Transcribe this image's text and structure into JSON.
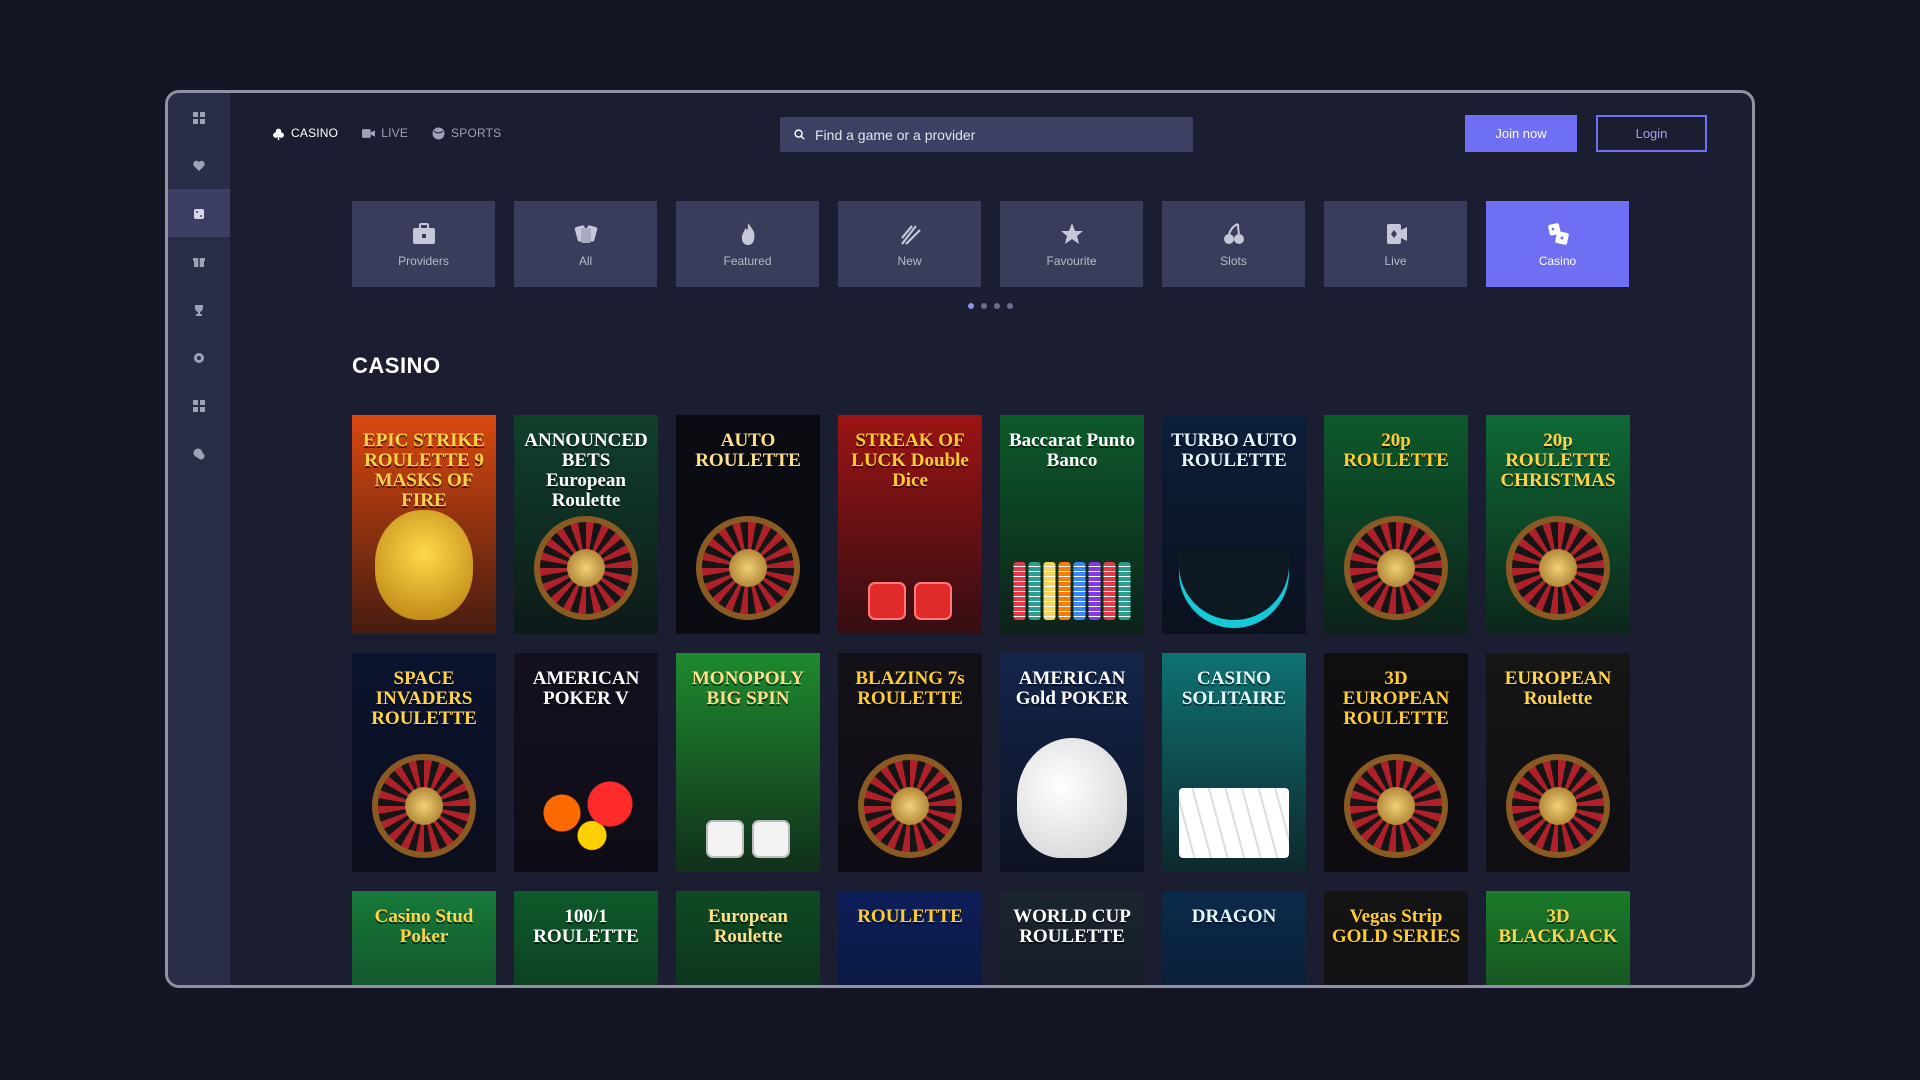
{
  "sidebar": {
    "items": [
      {
        "name": "sidebar-dashboard-icon",
        "active": false
      },
      {
        "name": "sidebar-favourites-icon",
        "active": false
      },
      {
        "name": "sidebar-casino-icon",
        "active": true
      },
      {
        "name": "sidebar-promotions-icon",
        "active": false
      },
      {
        "name": "sidebar-tournaments-icon",
        "active": false
      },
      {
        "name": "sidebar-settings-icon",
        "active": false
      },
      {
        "name": "sidebar-games-icon",
        "active": false
      },
      {
        "name": "sidebar-support-icon",
        "active": false
      }
    ]
  },
  "header": {
    "tabs": [
      {
        "label": "CASINO",
        "icon": "club-icon",
        "active": true
      },
      {
        "label": "LIVE",
        "icon": "live-camera-icon",
        "active": false
      },
      {
        "label": "SPORTS",
        "icon": "ball-icon",
        "active": false
      }
    ],
    "search_placeholder": "Find a game or a provider",
    "join_label": "Join now",
    "login_label": "Login"
  },
  "categories": [
    {
      "label": "Providers",
      "icon": "briefcase-icon",
      "active": false
    },
    {
      "label": "All",
      "icon": "cards-icon",
      "active": false
    },
    {
      "label": "Featured",
      "icon": "flame-icon",
      "active": false
    },
    {
      "label": "New",
      "icon": "sparkle-icon",
      "active": false
    },
    {
      "label": "Favourite",
      "icon": "star-icon",
      "active": false
    },
    {
      "label": "Slots",
      "icon": "cherry-icon",
      "active": false
    },
    {
      "label": "Live",
      "icon": "live-card-icon",
      "active": false
    },
    {
      "label": "Casino",
      "icon": "dice-icon",
      "active": true
    }
  ],
  "pagination": {
    "pages": 4,
    "current": 1
  },
  "section_title": "CASINO",
  "games": [
    {
      "title": "EPIC STRIKE ROULETTE 9 MASKS OF FIRE",
      "bg": "#d9480f",
      "art": "mask"
    },
    {
      "title": "ANNOUNCED BETS European Roulette",
      "bg": "#11402c",
      "art": "wheel"
    },
    {
      "title": "AUTO ROULETTE",
      "bg": "#0b0b12",
      "art": "wheel"
    },
    {
      "title": "STREAK OF LUCK Double Dice",
      "bg": "#9c1414",
      "art": "dice"
    },
    {
      "title": "Baccarat Punto Banco",
      "bg": "#0d5a2a",
      "art": "chips"
    },
    {
      "title": "TURBO AUTO ROULETTE",
      "bg": "#0b1f3a",
      "art": "bowl"
    },
    {
      "title": "20p ROULETTE",
      "bg": "#0d5a2c",
      "art": "wheel"
    },
    {
      "title": "20p ROULETTE CHRISTMAS",
      "bg": "#0f6a34",
      "art": "wheel"
    },
    {
      "title": "SPACE INVADERS ROULETTE",
      "bg": "#0b1430",
      "art": "wheel"
    },
    {
      "title": "AMERICAN POKER V",
      "bg": "#141020",
      "art": "fireworks"
    },
    {
      "title": "MONOPOLY BIG SPIN",
      "bg": "#1e8a2e",
      "art": "dice-white"
    },
    {
      "title": "BLAZING 7s ROULETTE",
      "bg": "#141018",
      "art": "wheel"
    },
    {
      "title": "AMERICAN Gold POKER",
      "bg": "#13254a",
      "art": "eagle"
    },
    {
      "title": "CASINO SOLITAIRE",
      "bg": "#0f7272",
      "art": "cards"
    },
    {
      "title": "3D EUROPEAN ROULETTE",
      "bg": "#0f0f0f",
      "art": "wheel"
    },
    {
      "title": "EUROPEAN Roulette",
      "bg": "#161616",
      "art": "wheel"
    },
    {
      "title": "Casino Stud Poker",
      "bg": "#177a3a",
      "art": "none"
    },
    {
      "title": "100/1 ROULETTE",
      "bg": "#0e5a2a",
      "art": "none"
    },
    {
      "title": "European Roulette",
      "bg": "#0e4a22",
      "art": "none"
    },
    {
      "title": "ROULETTE",
      "bg": "#0d1f5a",
      "art": "none"
    },
    {
      "title": "WORLD CUP ROULETTE",
      "bg": "#1b2530",
      "art": "none"
    },
    {
      "title": "DRAGON",
      "bg": "#0b2a4a",
      "art": "none"
    },
    {
      "title": "Vegas Strip GOLD SERIES",
      "bg": "#141414",
      "art": "none"
    },
    {
      "title": "3D BLACKJACK",
      "bg": "#1b7a2a",
      "art": "none"
    }
  ],
  "colors": {
    "accent": "#6e6ff2",
    "background": "#1b1d30",
    "sidebar": "#2a2d48",
    "tile": "#3a3c5b"
  }
}
